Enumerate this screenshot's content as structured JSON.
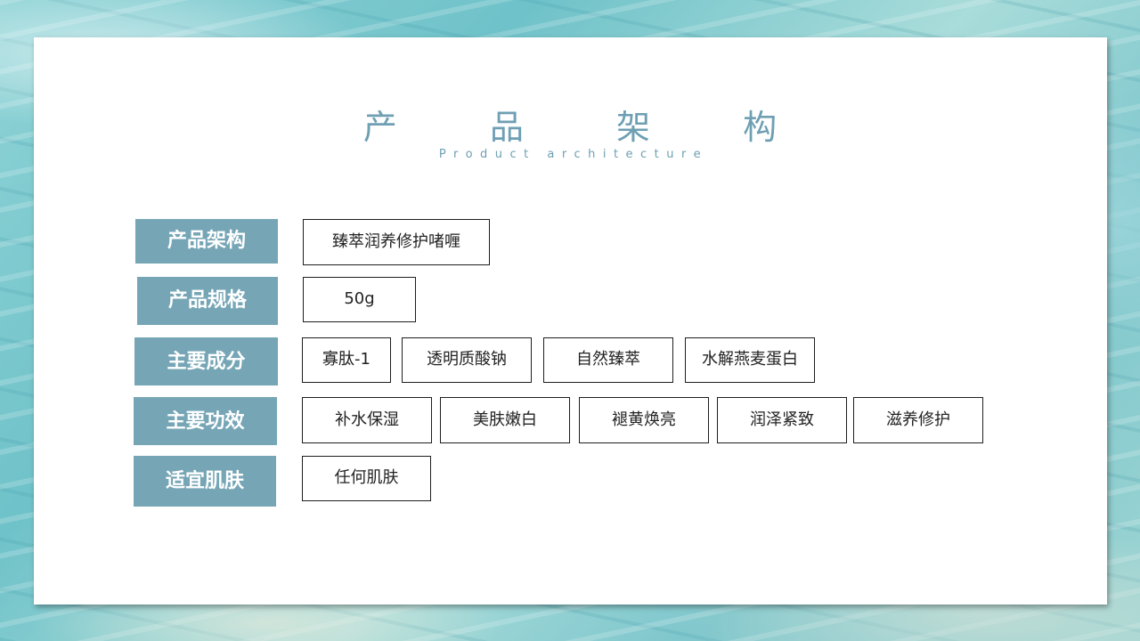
{
  "slide": {
    "title": "产 品 架 构",
    "subtitle": "Product architecture"
  },
  "rows": [
    {
      "label": "产品架构",
      "tags": [
        "臻萃润养修护啫喱"
      ]
    },
    {
      "label": "产品规格",
      "tags": [
        "50g"
      ]
    },
    {
      "label": "主要成分",
      "tags": [
        "寡肽-1",
        "透明质酸钠",
        "自然臻萃",
        "水解燕麦蛋白"
      ]
    },
    {
      "label": "主要功效",
      "tags": [
        "补水保湿",
        "美肤嫩白",
        "褪黄焕亮",
        "润泽紧致",
        "滋养修护"
      ]
    },
    {
      "label": "适宜肌肤",
      "tags": [
        "任何肌肤"
      ]
    }
  ],
  "colors": {
    "label_bg": "#76a6b6",
    "title": "#6e9fb3",
    "tag_border": "#1e1e1e"
  }
}
